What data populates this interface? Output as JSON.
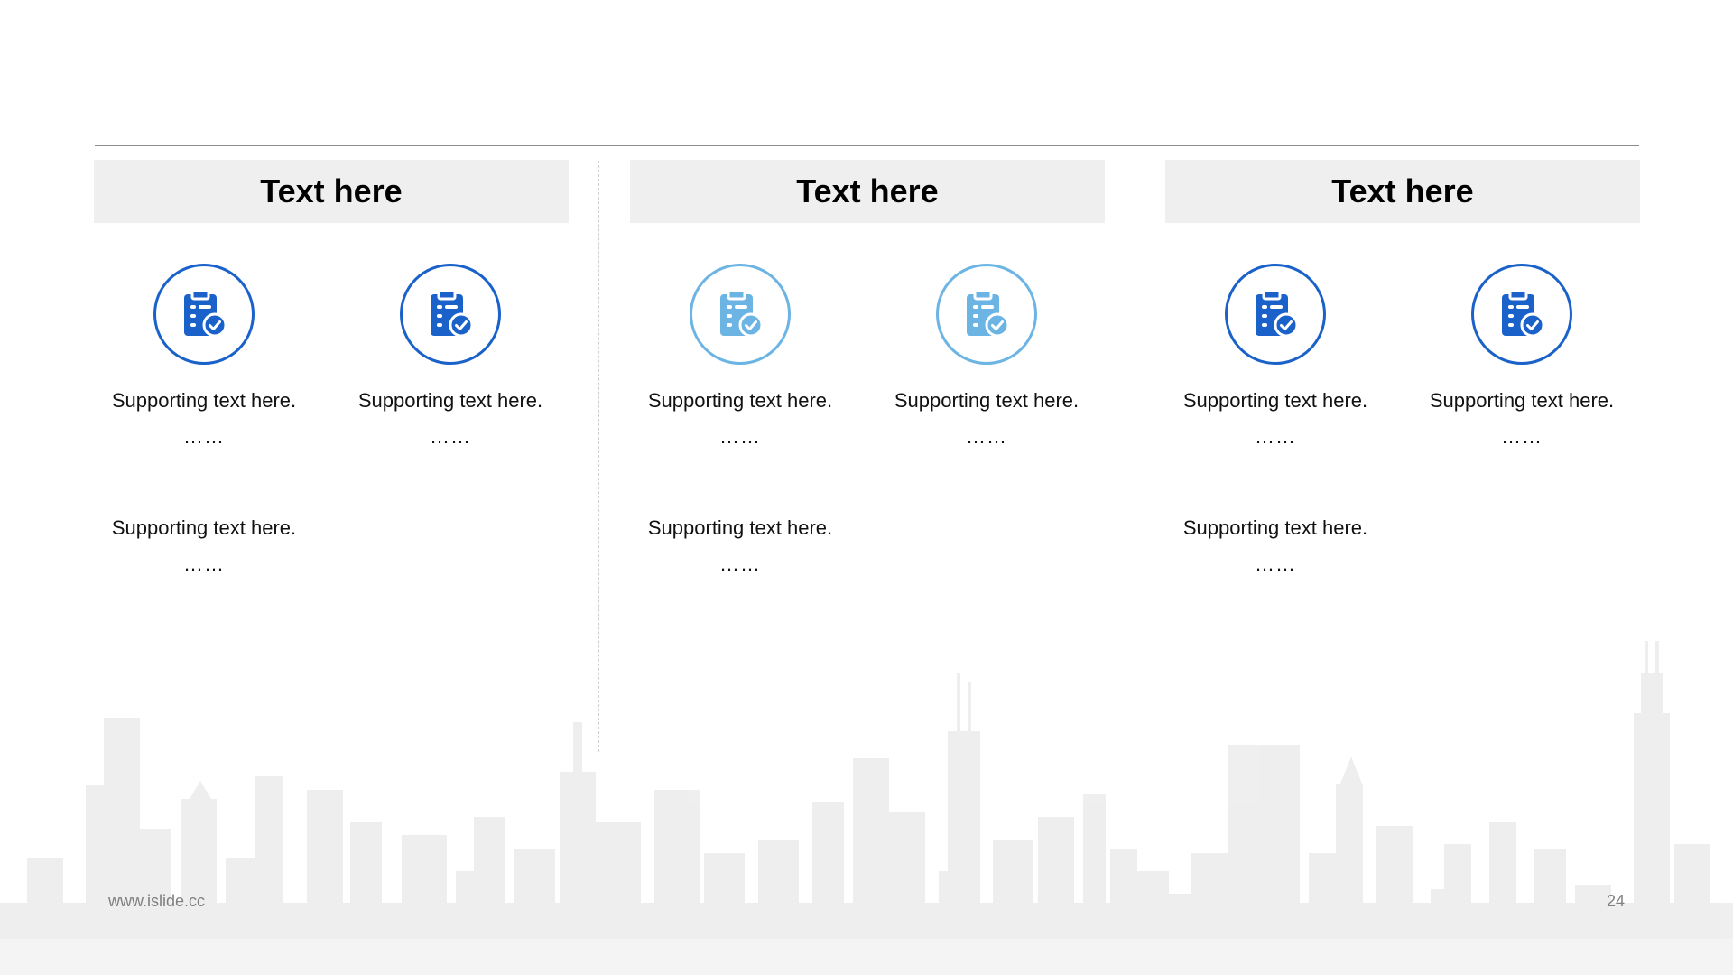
{
  "columns": [
    {
      "title": "Text here",
      "icon_style": "dark",
      "icon_color": "#1a62c9",
      "items": [
        {
          "text": "Supporting text here.",
          "dots": "……"
        },
        {
          "text": "Supporting text here.",
          "dots": "……"
        },
        {
          "text": "Supporting text here.",
          "dots": "……"
        }
      ]
    },
    {
      "title": "Text here",
      "icon_style": "light",
      "icon_color": "#6cb4e4",
      "items": [
        {
          "text": "Supporting text here.",
          "dots": "……"
        },
        {
          "text": "Supporting text here.",
          "dots": "……"
        },
        {
          "text": "Supporting text here.",
          "dots": "……"
        }
      ]
    },
    {
      "title": "Text here",
      "icon_style": "dark",
      "icon_color": "#1a62c9",
      "items": [
        {
          "text": "Supporting text here.",
          "dots": "……"
        },
        {
          "text": "Supporting text here.",
          "dots": "……"
        },
        {
          "text": "Supporting text here.",
          "dots": "……"
        }
      ]
    }
  ],
  "icons": {
    "item_icon": "clipboard-check-icon"
  },
  "footer": {
    "url": "www.islide.cc",
    "page_number": "24"
  }
}
